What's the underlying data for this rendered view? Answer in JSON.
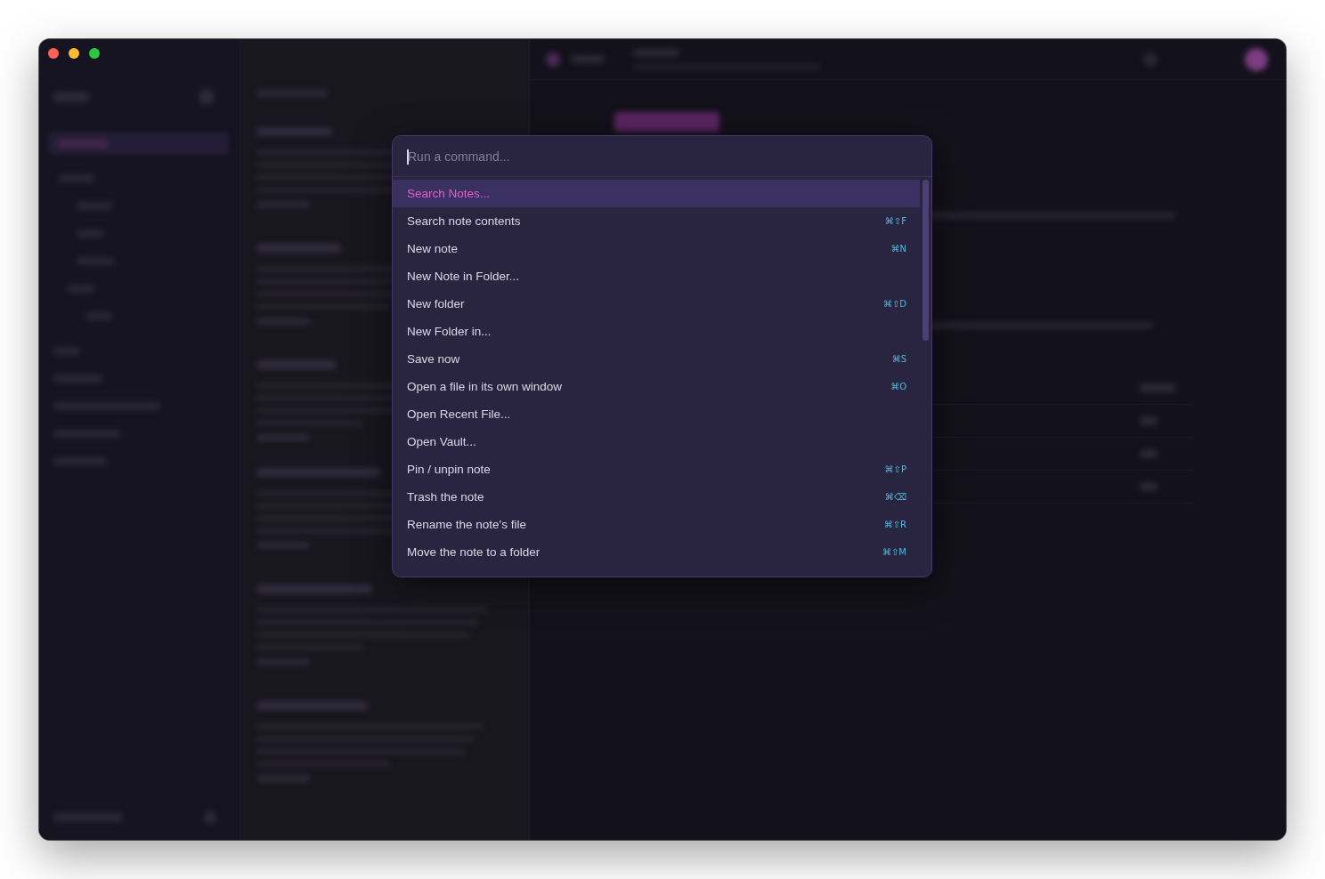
{
  "command_palette": {
    "placeholder": "Run a command...",
    "commands": [
      {
        "label": "Search Notes...",
        "selected": true
      },
      {
        "label": "Search note contents",
        "shortcut": "⌘⇧F",
        "selected": false
      },
      {
        "label": "New note",
        "shortcut": "⌘N",
        "selected": false
      },
      {
        "label": "New Note in Folder...",
        "selected": false
      },
      {
        "label": "New folder",
        "shortcut": "⌘⇧D",
        "selected": false
      },
      {
        "label": "New Folder in...",
        "selected": false
      },
      {
        "label": "Save now",
        "shortcut": "⌘S",
        "selected": false
      },
      {
        "label": "Open a file in its own window",
        "shortcut": "⌘O",
        "selected": false
      },
      {
        "label": "Open Recent File...",
        "selected": false
      },
      {
        "label": "Open Vault...",
        "selected": false
      },
      {
        "label": "Pin / unpin note",
        "shortcut": "⌘⇧P",
        "selected": false
      },
      {
        "label": "Trash the note",
        "shortcut": "⌘⌫",
        "selected": false
      },
      {
        "label": "Rename the note's file",
        "shortcut": "⌘⇧R",
        "selected": false
      },
      {
        "label": "Move the note to a folder",
        "shortcut": "⌘⇧M",
        "selected": false
      }
    ]
  }
}
